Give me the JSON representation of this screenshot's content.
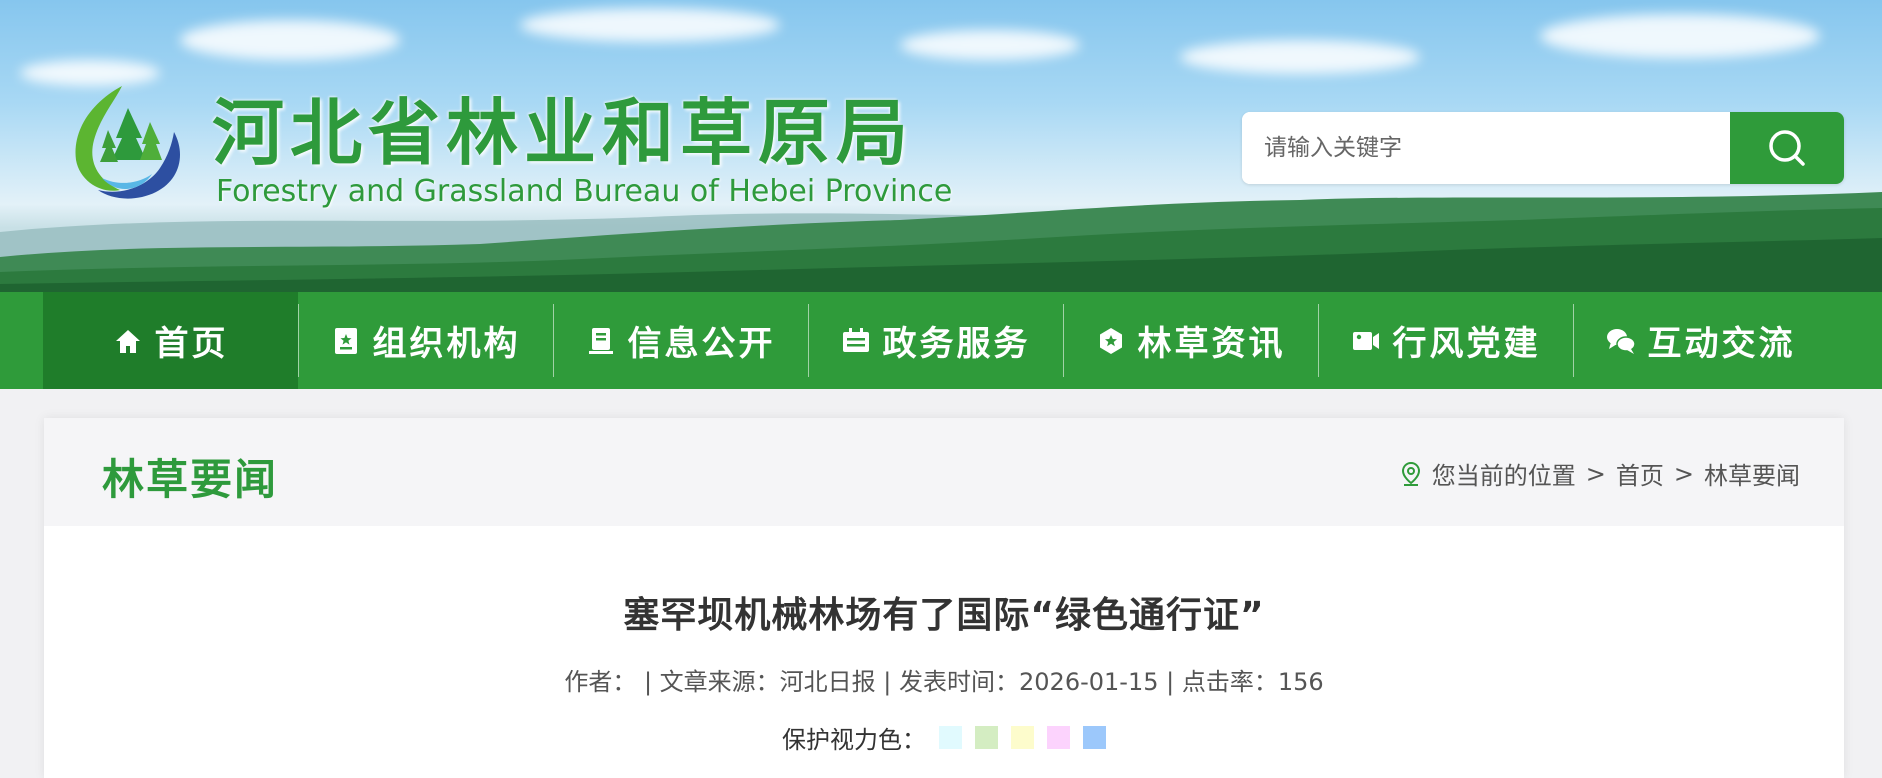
{
  "header": {
    "title_cn": "河北省林业和草原局",
    "title_en": "Forestry and Grassland Bureau of Hebei Province",
    "logo_icon": "forest-logo-icon"
  },
  "search": {
    "placeholder": "请输入关键字",
    "button_icon": "search-icon"
  },
  "nav": {
    "items": [
      {
        "label": "首页",
        "icon": "home-icon",
        "active": true
      },
      {
        "label": "组织机构",
        "icon": "org-icon"
      },
      {
        "label": "信息公开",
        "icon": "info-icon"
      },
      {
        "label": "政务服务",
        "icon": "service-icon"
      },
      {
        "label": "林草资讯",
        "icon": "news-icon"
      },
      {
        "label": "行风党建",
        "icon": "party-icon"
      },
      {
        "label": "互动交流",
        "icon": "chat-icon"
      }
    ]
  },
  "section": {
    "title": "林草要闻"
  },
  "breadcrumb": {
    "prefix": "您当前的位置",
    "items": [
      "首页",
      "林草要闻"
    ],
    "separator": ">"
  },
  "article": {
    "title": "塞罕坝机械林场有了国际“绿色通行证”",
    "meta": "作者：  | 文章来源：河北日报 | 发表时间：2026-01-15 | 点击率：156"
  },
  "eye_care": {
    "label": "保护视力色：",
    "colors": [
      "#e1fafe",
      "#d4edc2",
      "#fdfccc",
      "#fcd3fd",
      "#9cc8fb"
    ]
  },
  "colors": {
    "brand_green": "#2f9b3a",
    "nav_active": "#1f7d2a"
  }
}
